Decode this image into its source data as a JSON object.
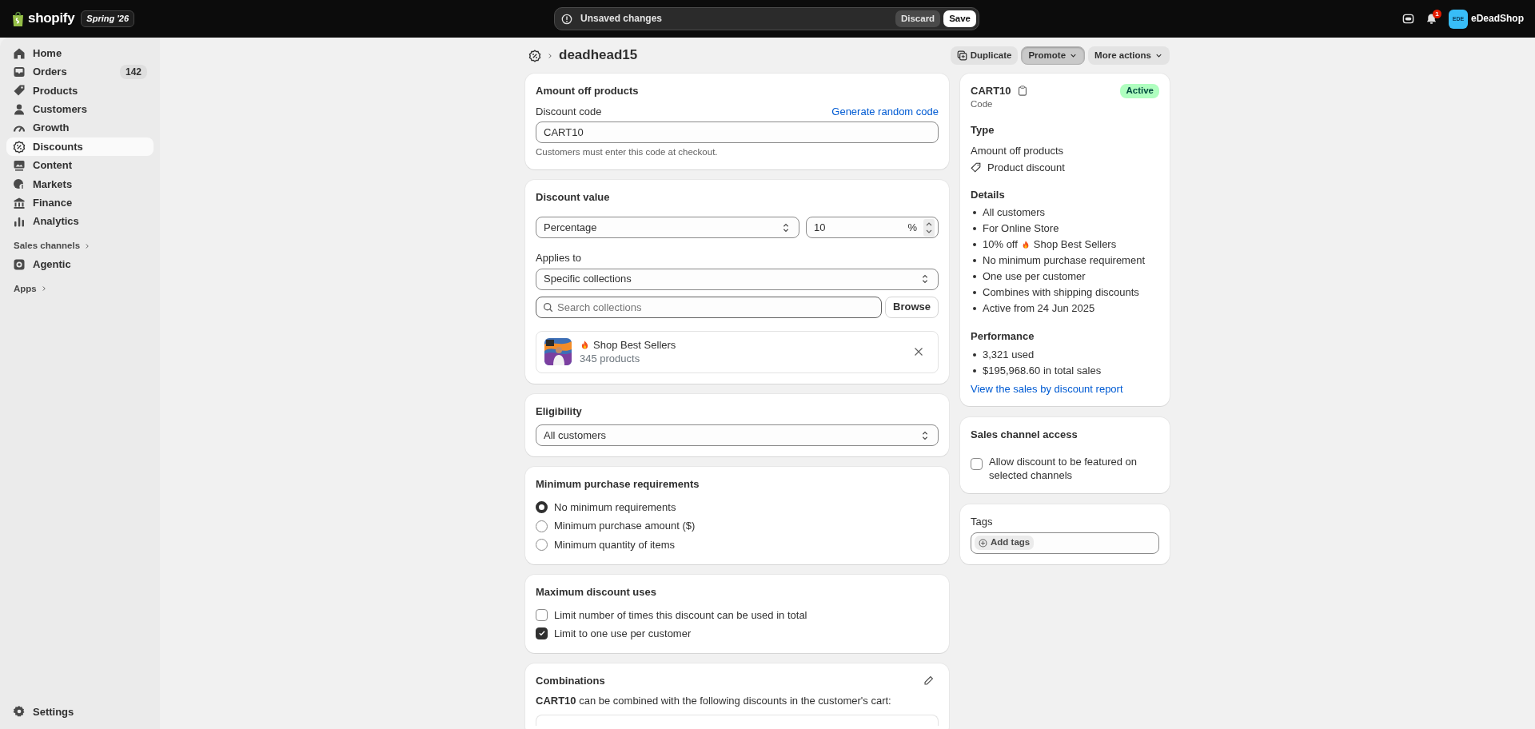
{
  "topbar": {
    "logo": "shopify",
    "edition": "Spring '26",
    "unsaved": {
      "message": "Unsaved changes",
      "buttons": [
        {
          "label": "Discard",
          "kind": "secondary"
        },
        {
          "label": "Save",
          "kind": "primary"
        }
      ]
    },
    "notification_count": "1",
    "store": {
      "initials": "EDE",
      "name": "eDeadShop"
    }
  },
  "sidebar": {
    "items": [
      {
        "label": "Home",
        "selected": false
      },
      {
        "label": "Orders",
        "selected": false,
        "badge": "142"
      },
      {
        "label": "Products",
        "selected": false
      },
      {
        "label": "Customers",
        "selected": false
      },
      {
        "label": "Growth",
        "selected": false
      },
      {
        "label": "Discounts",
        "selected": true
      },
      {
        "label": "Content",
        "selected": false
      },
      {
        "label": "Markets",
        "selected": false
      },
      {
        "label": "Finance",
        "selected": false
      },
      {
        "label": "Analytics",
        "selected": false
      }
    ],
    "sections": [
      {
        "label": "Sales channels",
        "items": [
          {
            "label": "Agentic",
            "selected": false
          }
        ]
      },
      {
        "label": "Apps"
      }
    ],
    "settings": "Settings"
  },
  "page": {
    "title": "deadhead15",
    "actions": [
      {
        "label": "Duplicate",
        "pressed": false,
        "menu": false
      },
      {
        "label": "Promote",
        "pressed": true,
        "menu": true
      },
      {
        "label": "More actions",
        "pressed": false,
        "menu": true
      }
    ]
  },
  "method_card": {
    "title": "Amount off products",
    "code_label": "Discount code",
    "generate_link": "Generate random code",
    "code_value": "CART10",
    "help": "Customers must enter this code at checkout."
  },
  "value_card": {
    "title": "Discount value",
    "type_value": "Percentage",
    "amount": "10",
    "suffix": "%",
    "applies_label": "Applies to",
    "applies_value": "Specific collections",
    "search_placeholder": "Search collections",
    "browse": "Browse",
    "collections": [
      {
        "name": "Shop Best Sellers",
        "count": "345 products"
      }
    ]
  },
  "eligibility_card": {
    "title": "Eligibility",
    "value": "All customers"
  },
  "minimum_card": {
    "title": "Minimum purchase requirements",
    "options": [
      {
        "label": "No minimum requirements",
        "selected": true
      },
      {
        "label": "Minimum purchase amount ($)",
        "selected": false
      },
      {
        "label": "Minimum quantity of items",
        "selected": false
      }
    ]
  },
  "max_uses_card": {
    "title": "Maximum discount uses",
    "options": [
      {
        "label": "Limit number of times this discount can be used in total",
        "checked": false
      },
      {
        "label": "Limit to one use per customer",
        "checked": true
      }
    ]
  },
  "combinations_card": {
    "title": "Combinations",
    "text": "**CART10** can be combined with the following discounts in the customer's cart:"
  },
  "summary_card": {
    "code": "CART10",
    "code_caption": "Code",
    "status": "Active",
    "type_heading": "Type",
    "type_value": "Amount off products",
    "type_kind": "Product discount",
    "details_heading": "Details",
    "details": [
      {
        "text": "All customers"
      },
      {
        "text": "For Online Store"
      },
      {
        "text": "10% off",
        "collection": "Shop Best Sellers"
      },
      {
        "text": "No minimum purchase requirement"
      },
      {
        "text": "One use per customer"
      },
      {
        "text": "Combines with shipping discounts"
      },
      {
        "text": "Active from 24 Jun 2025"
      }
    ],
    "performance_heading": "Performance",
    "performance": [
      "3,321 used",
      "$195,968.60 in total sales"
    ],
    "report_link": "View the sales by discount report"
  },
  "channel_card": {
    "title": "Sales channel access",
    "label": "Allow discount to be featured on selected channels",
    "checked": false
  },
  "tags_card": {
    "title": "Tags",
    "add": "Add tags"
  }
}
